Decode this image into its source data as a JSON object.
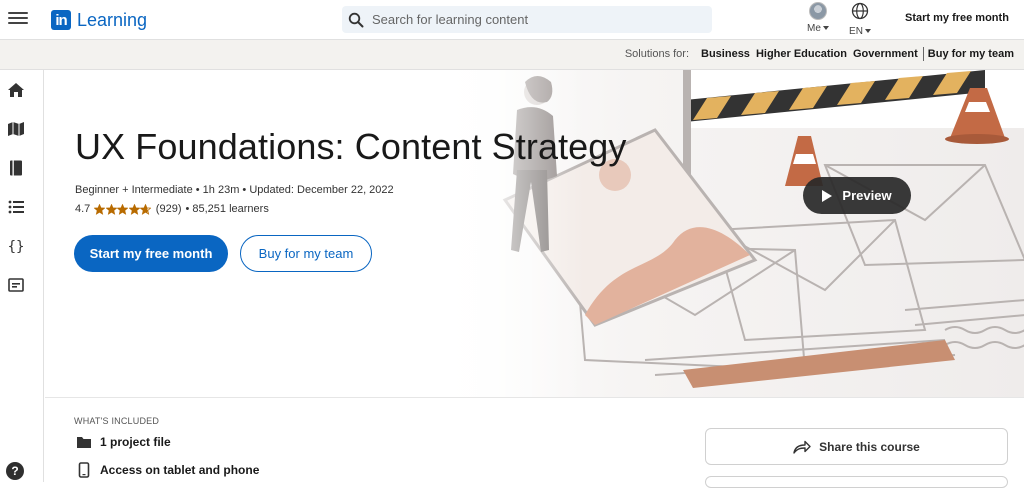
{
  "header": {
    "logo_mark": "in",
    "logo_word": "Learning",
    "search_placeholder": "Search for learning content",
    "me_label": "Me",
    "lang_label": "EN",
    "start_label": "Start my free month"
  },
  "subbar": {
    "label": "Solutions for:",
    "links": [
      "Business",
      "Higher Education",
      "Government",
      "Buy for my team"
    ]
  },
  "sidebar": {
    "icons": [
      "home-icon",
      "map-icon",
      "book-icon",
      "list-icon",
      "code-icon",
      "card-icon"
    ],
    "help_label": "?"
  },
  "course": {
    "title": "UX Foundations: Content Strategy",
    "meta": "Beginner + Intermediate • 1h 23m • Updated: December 22, 2022",
    "rating_value": "4.7",
    "rating_stars": 4.7,
    "rating_count": "(929)",
    "learners": "• 85,251 learners",
    "primary_btn": "Start my free month",
    "secondary_btn": "Buy for my team",
    "preview_label": "Preview"
  },
  "included": {
    "heading": "WHAT'S INCLUDED",
    "items": [
      {
        "icon": "folder-icon",
        "label": "1 project file"
      },
      {
        "icon": "phone-icon",
        "label": "Access on tablet and phone"
      }
    ]
  },
  "share": {
    "label": "Share this course"
  },
  "colors": {
    "brand": "#0a66c2",
    "star": "#b86b00",
    "dark_pill": "#282828"
  }
}
